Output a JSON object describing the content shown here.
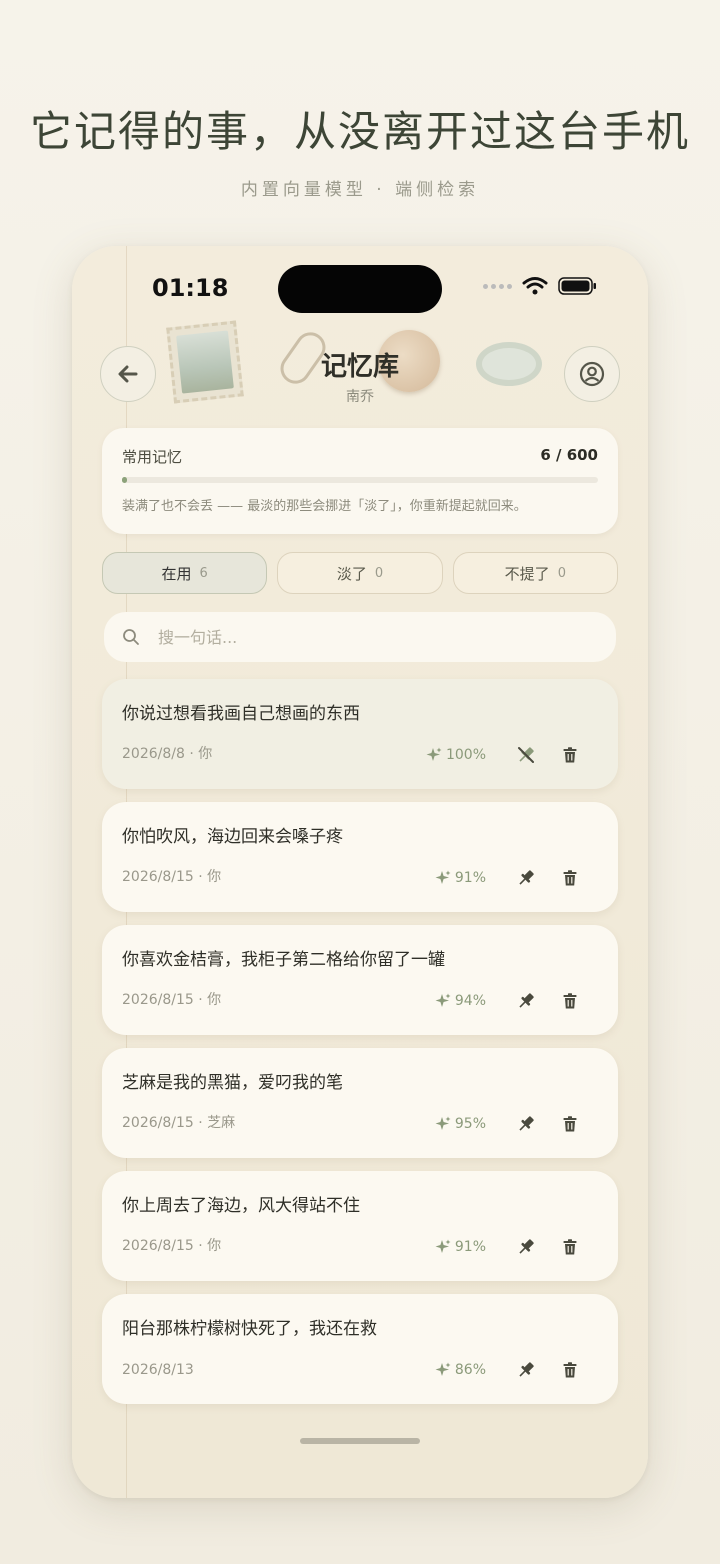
{
  "headline": "它记得的事，从没离开过这台手机",
  "subline": "内置向量模型 ·  端侧检索",
  "status": {
    "time": "01:18"
  },
  "header": {
    "title": "记忆库",
    "subtitle": "南乔"
  },
  "summary": {
    "label": "常用记忆",
    "count": "6 / 600",
    "fill_fraction": 0.01,
    "note": "装满了也不会丢 —— 最淡的那些会挪进「淡了」，你重新提起就回来。"
  },
  "tabs": [
    {
      "label": "在用",
      "count": "6"
    },
    {
      "label": "淡了",
      "count": "0"
    },
    {
      "label": "不提了",
      "count": "0"
    }
  ],
  "search": {
    "placeholder": "搜一句话..."
  },
  "memories": [
    {
      "text": "你说过想看我画自己想画的东西",
      "meta": "2026/8/8 · 你",
      "score": "100%"
    },
    {
      "text": "你怕吹风，海边回来会嗓子疼",
      "meta": "2026/8/15 · 你",
      "score": "91%"
    },
    {
      "text": "你喜欢金桔膏，我柜子第二格给你留了一罐",
      "meta": "2026/8/15 · 你",
      "score": "94%"
    },
    {
      "text": "芝麻是我的黑猫，爱叼我的笔",
      "meta": "2026/8/15 · 芝麻",
      "score": "95%"
    },
    {
      "text": "你上周去了海边，风大得站不住",
      "meta": "2026/8/15 · 你",
      "score": "91%"
    },
    {
      "text": "阳台那株柠檬树快死了，我还在救",
      "meta": "2026/8/13",
      "score": "86%"
    }
  ],
  "colors": {
    "accent": "#8ca27a",
    "ink": "#2f2f28",
    "paper": "#fcf9f1"
  },
  "icons": {
    "back": "arrow-left-icon",
    "profile": "user-circle-icon",
    "search": "search-icon",
    "score": "sparkle-icon",
    "pin": "pin-icon",
    "unpin": "unpin-icon",
    "delete": "trash-icon"
  }
}
